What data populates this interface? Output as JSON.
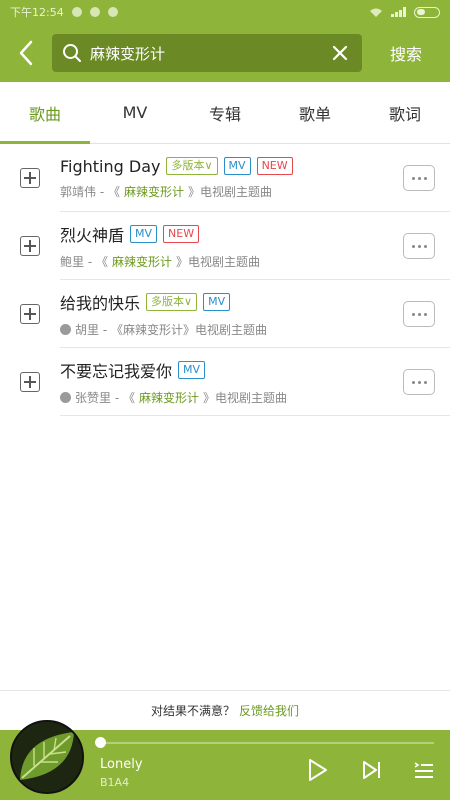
{
  "status_bar": {
    "time": "下午12:54"
  },
  "header": {
    "search_value": "麻辣变形计",
    "search_button": "搜索"
  },
  "tabs": [
    {
      "label": "歌曲"
    },
    {
      "label": "MV"
    },
    {
      "label": "专辑"
    },
    {
      "label": "歌单"
    },
    {
      "label": "歌词"
    }
  ],
  "songs": [
    {
      "title": "Fighting Day",
      "badges": {
        "version": "多版本",
        "mv": "MV",
        "new": "NEW"
      },
      "sub": {
        "pre": "郭靖伟 - 《",
        "hl": "麻辣变形计",
        "post": "》电视剧主题曲"
      }
    },
    {
      "title": "烈火神盾",
      "badges": {
        "mv": "MV",
        "new": "NEW"
      },
      "sub": {
        "pre": "鲍里 - 《",
        "hl": "麻辣变形计",
        "post": "》电视剧主题曲"
      }
    },
    {
      "title": "给我的快乐",
      "badges": {
        "version": "多版本",
        "mv": "MV"
      },
      "sub": {
        "pre": "胡里 - 《麻辣变形计》电视剧主题曲"
      }
    },
    {
      "title": "不要忘记我爱你",
      "badges": {
        "mv": "MV"
      },
      "sub": {
        "pre": "张赞里 - 《",
        "hl": "麻辣变形计",
        "post": "》电视剧主题曲"
      }
    }
  ],
  "feedback": {
    "text": "对结果不满意？",
    "link": "反馈给我们"
  },
  "player": {
    "title": "Lonely",
    "artist": "B1A4",
    "progress": 0
  },
  "colors": {
    "accent": "#8fb43a",
    "accent_dark": "#6b8a26",
    "mv_badge": "#2a8ec8",
    "new_badge": "#e5484d"
  },
  "icons": [
    "back-arrow-icon",
    "search-icon",
    "close-icon",
    "add-icon",
    "more-icon",
    "globe-icon",
    "play-icon",
    "next-icon",
    "playlist-icon"
  ]
}
